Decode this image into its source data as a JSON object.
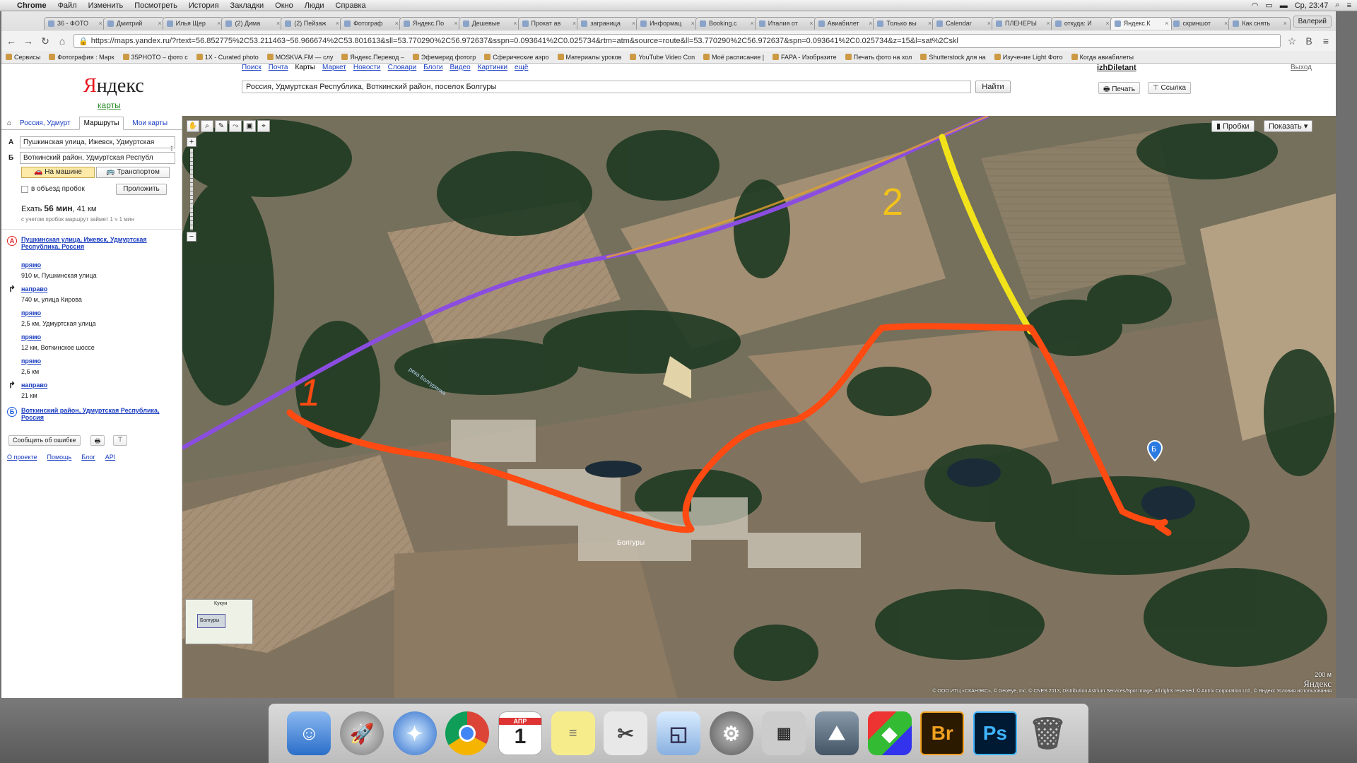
{
  "macbar": {
    "apple": "",
    "menus": [
      "Chrome",
      "Файл",
      "Изменить",
      "Посмотреть",
      "История",
      "Закладки",
      "Окно",
      "Люди",
      "Справка"
    ],
    "clock": "Ср, 23:47"
  },
  "browser": {
    "tabs": [
      "36 - ФОТО",
      "Дмитрий",
      "Илья Щер",
      "(2) Дима",
      "(2) Пейзаж",
      "Фотограф",
      "Яндекс.По",
      "Дешевые",
      "Прокат ав",
      "заграница",
      "Информац",
      "Booking.c",
      "Италия от",
      "Авиабилет",
      "Только вы",
      "Calendar",
      "ПЛЕНЕРЫ",
      "откуда: И",
      "Яндекс.К",
      "скриншот",
      "Как снять"
    ],
    "active_tab": 18,
    "profile": "Валерий",
    "url": "https://maps.yandex.ru/?rtext=56.852775%2C53.211463~56.966674%2C53.801613&sll=53.770290%2C56.972637&sspn=0.093641%2C0.025734&rtm=atm&source=route&ll=53.770290%2C56.972637&spn=0.093641%2C0.025734&z=15&l=sat%2Cskl",
    "bookmarks": [
      "Сервисы",
      "Фотография : Марк",
      "35PHOTO – фото с",
      "1X - Curated photo",
      "MOSKVA.FM — слу",
      "Яндекс.Перевод –",
      "Эфемерид фотогр",
      "Сферические аэро",
      "Материалы уроков",
      "YouTube Video Con",
      "Моё расписание |",
      "FAPA - Изобразите",
      "Печать фото на хол",
      "Shutterstock для на",
      "Изучение Light Фото",
      "Когда авиабилеты"
    ]
  },
  "header": {
    "logo_prefix": "Я",
    "logo_rest": "ндекс",
    "logo_sub": "карты",
    "services": [
      "Поиск",
      "Почта",
      "Карты",
      "Маркет",
      "Новости",
      "Словари",
      "Блоги",
      "Видео",
      "Картинки",
      "ещё"
    ],
    "current_service": "Карты",
    "search_value": "Россия, Удмуртская Республика, Воткинский район, поселок Болгуры",
    "find_label": "Найти",
    "user": "izhDiletant",
    "logout": "Выход",
    "print_label": "Печать",
    "link_label": "Ссылка"
  },
  "sidebar": {
    "tabs": [
      "Россия, Удмурт",
      "Маршруты",
      "Мои карты"
    ],
    "current_tab": "Маршруты",
    "point_a_label": "А",
    "point_a_value": "Пушкинская улица, Ижевск, Удмуртская",
    "point_b_label": "Б",
    "point_b_value": "Воткинский район, Удмуртская Республ",
    "mode_car": "На машине",
    "mode_transport": "Транспортом",
    "avoid_traffic": "в объезд пробок",
    "plot_button": "Проложить",
    "summary_prefix": "Ехать ",
    "summary_time": "56 мин",
    "summary_dist": ", 41 км",
    "summary_note": "с учетом пробок маршрут займет 1 ч 1 мин",
    "start_point": "Пушкинская улица, Ижевск, Удмуртская Республика, Россия",
    "steps": [
      {
        "dir": "прямо",
        "detail": "910 м, Пушкинская улица"
      },
      {
        "dir": "направо",
        "detail": "740 м, улица Кирова"
      },
      {
        "dir": "прямо",
        "detail": "2,5 км, Удмуртская улица"
      },
      {
        "dir": "прямо",
        "detail": "12 км, Воткинское шоссе"
      },
      {
        "dir": "прямо",
        "detail": "2,6 км"
      },
      {
        "dir": "направо",
        "detail": "21 км"
      }
    ],
    "end_point": "Воткинский район, Удмуртская Республика, Россия",
    "report_error": "Сообщить об ошибке",
    "footer_links": [
      "О проекте",
      "Помощь",
      "Блог",
      "API"
    ]
  },
  "map": {
    "traffic_label": "Пробки",
    "show_label": "Показать ▾",
    "annotation_1": "1",
    "annotation_2": "2",
    "place_bolgury": "Болгуры",
    "river_label": "река Болгуринка",
    "minimap_label_1": "Кукуи",
    "minimap_label_2": "Болгуры",
    "marker_b": "Б",
    "scale": "200 м",
    "copyright": "© ООО ИТЦ «СКАНЭКС», © GeoEye, Inc. © CNES 2013, Distribution Astrium Services/Spot Image, all rights reserved. © Antrix Corporation Ltd., © Яндекс  Условия использования",
    "yandex_mark": "Яндекс",
    "colors": {
      "route_orange": "#ff4a12",
      "route_yellow": "#f2e21a",
      "highway_purple": "#8a4de0"
    }
  },
  "dock": {
    "icons": [
      "finder-icon",
      "launchpad-icon",
      "safari-icon",
      "chrome-icon",
      "calendar-icon",
      "stickies-icon",
      "scissors-icon",
      "preview-icon",
      "system-preferences-icon",
      "calculator-icon",
      "photo-icon",
      "maps-icon",
      "bridge-icon",
      "photoshop-icon",
      "trash-icon"
    ],
    "calendar_day": "1",
    "calendar_month": "АПР",
    "bridge": "Br",
    "photoshop": "Ps"
  }
}
